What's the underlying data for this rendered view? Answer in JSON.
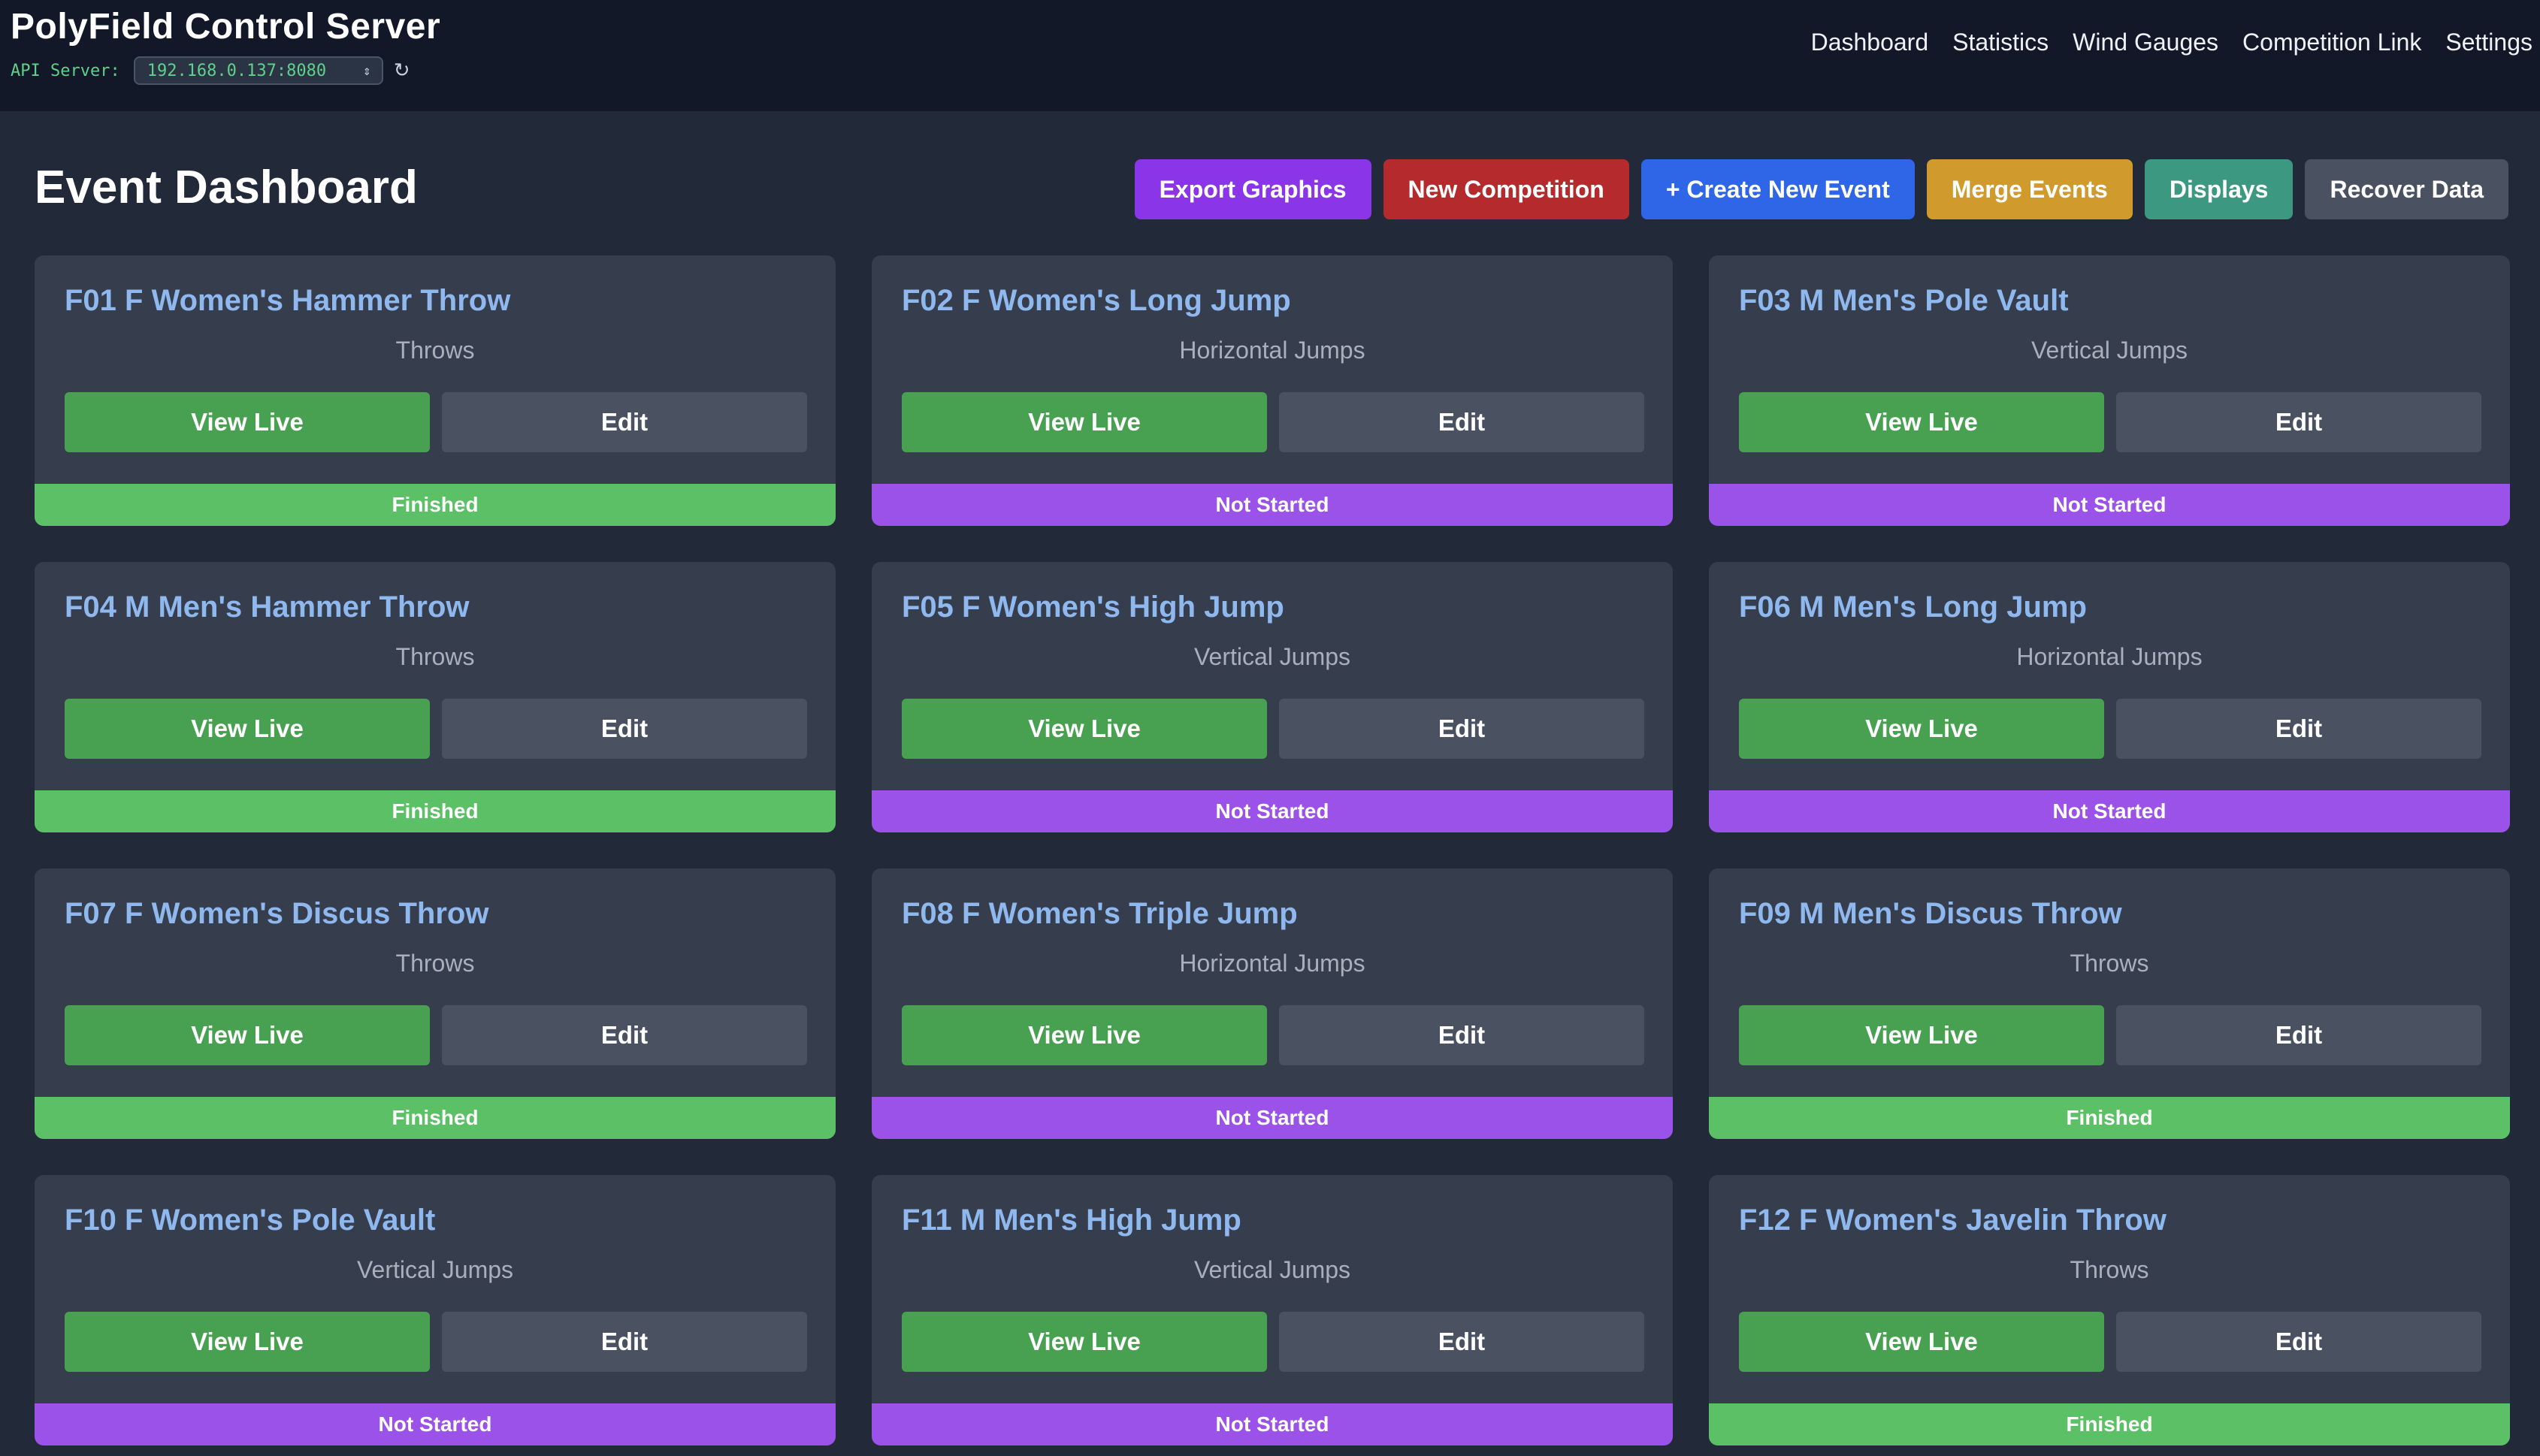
{
  "header": {
    "app_title": "PolyField Control Server",
    "api_label": "API Server:",
    "api_server_value": "192.168.0.137:8080",
    "nav": [
      "Dashboard",
      "Statistics",
      "Wind Gauges",
      "Competition Link",
      "Settings"
    ]
  },
  "page": {
    "title": "Event Dashboard",
    "actions": {
      "export": "Export Graphics",
      "new_competition": "New Competition",
      "create_event": "+ Create New Event",
      "merge": "Merge Events",
      "displays": "Displays",
      "recover": "Recover Data"
    }
  },
  "labels": {
    "view_live": "View Live",
    "edit": "Edit"
  },
  "colors": {
    "finished": "#5cc066",
    "not_started": "#9b52e8",
    "title_blue": "#8fb8ef",
    "view_live": "#48a151"
  },
  "events": [
    {
      "title": "F01 F Women's Hammer Throw",
      "category": "Throws",
      "status": "Finished"
    },
    {
      "title": "F02 F Women's Long Jump",
      "category": "Horizontal Jumps",
      "status": "Not Started"
    },
    {
      "title": "F03 M Men's Pole Vault",
      "category": "Vertical Jumps",
      "status": "Not Started"
    },
    {
      "title": "F04 M Men's Hammer Throw",
      "category": "Throws",
      "status": "Finished"
    },
    {
      "title": "F05 F Women's High Jump",
      "category": "Vertical Jumps",
      "status": "Not Started"
    },
    {
      "title": "F06 M Men's Long Jump",
      "category": "Horizontal Jumps",
      "status": "Not Started"
    },
    {
      "title": "F07 F Women's Discus Throw",
      "category": "Throws",
      "status": "Finished"
    },
    {
      "title": "F08 F Women's Triple Jump",
      "category": "Horizontal Jumps",
      "status": "Not Started"
    },
    {
      "title": "F09 M Men's Discus Throw",
      "category": "Throws",
      "status": "Finished"
    },
    {
      "title": "F10 F Women's Pole Vault",
      "category": "Vertical Jumps",
      "status": "Not Started"
    },
    {
      "title": "F11 M Men's High Jump",
      "category": "Vertical Jumps",
      "status": "Not Started"
    },
    {
      "title": "F12 F Women's Javelin Throw",
      "category": "Throws",
      "status": "Finished"
    }
  ]
}
